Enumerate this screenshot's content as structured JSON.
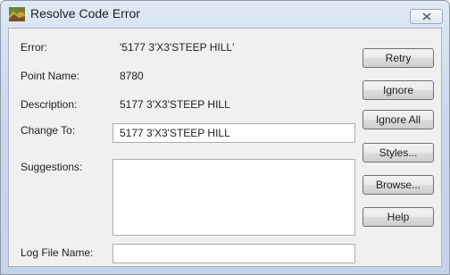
{
  "window": {
    "title": "Resolve Code Error"
  },
  "form": {
    "error_label": "Error:",
    "error_value": "'5177 3'X3'STEEP HILL'",
    "point_name_label": "Point Name:",
    "point_name_value": "8780",
    "description_label": "Description:",
    "description_value": "5177 3'X3'STEEP HILL",
    "change_to_label": "Change To:",
    "change_to_value": "5177 3'X3'STEEP HILL",
    "suggestions_label": "Suggestions:",
    "suggestions_items": [],
    "log_file_label": "Log File Name:",
    "log_file_value": ""
  },
  "buttons": {
    "retry": "Retry",
    "ignore": "Ignore",
    "ignore_all": "Ignore All",
    "styles": "Styles...",
    "browse": "Browse...",
    "help": "Help"
  },
  "icons": {
    "app": "map-terrain-icon",
    "close": "close-icon"
  }
}
